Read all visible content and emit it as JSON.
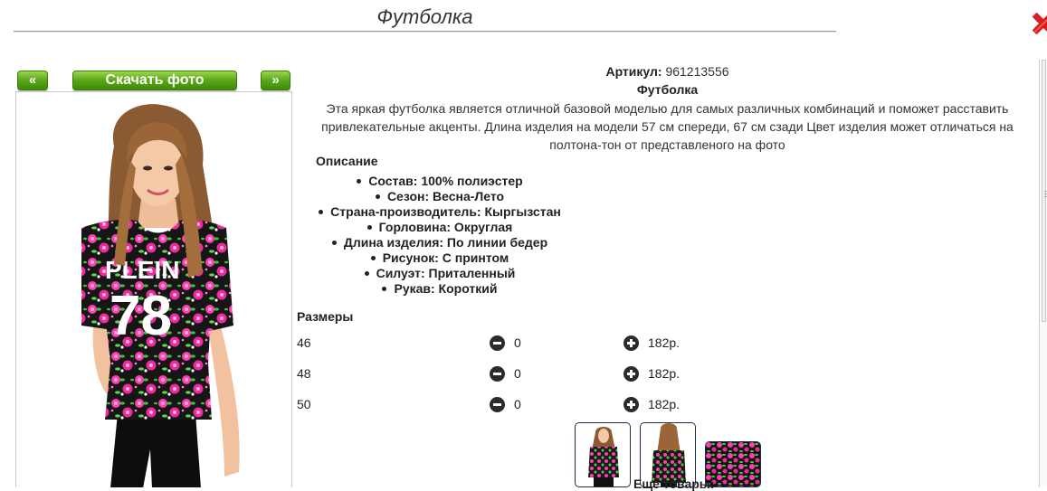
{
  "page_title": "Футболка",
  "gallery": {
    "prev_label": "«",
    "next_label": "»",
    "download_label": "Скачать фото"
  },
  "product": {
    "sku_label": "Артикул:",
    "sku_value": "961213556",
    "name": "Футболка",
    "description": "Эта яркая футболка является отличной базовой моделью для самых различных комбинаций и поможет расставить привлекательные акценты. Длина изделия на модели 57 см спереди, 67 см сзади Цвет изделия может отличаться на полтона-тон от представленого на фото"
  },
  "specs": {
    "heading": "Описание",
    "items": [
      "Состав: 100% полиэстер",
      "Сезон: Весна-Лето",
      "Страна-производитель: Кыргызстан",
      "Горловина: Округлая",
      "Длина изделия: По линии бедер",
      "Рисунок: С принтом",
      "Силуэт: Приталенный",
      "Рукав: Короткий"
    ]
  },
  "sizes": {
    "heading": "Размеры",
    "rows": [
      {
        "size": "46",
        "qty": "0",
        "price": "182р."
      },
      {
        "size": "48",
        "qty": "0",
        "price": "182р."
      },
      {
        "size": "50",
        "qty": "0",
        "price": "182р."
      }
    ]
  },
  "more_label": "Ещё товары:",
  "shirt_print": {
    "line1": "PLEIN",
    "line2": "78"
  },
  "colors": {
    "button_green": "#5aa619",
    "close_red": "#d81e1e",
    "thumb_border": "#1c2f4a"
  }
}
